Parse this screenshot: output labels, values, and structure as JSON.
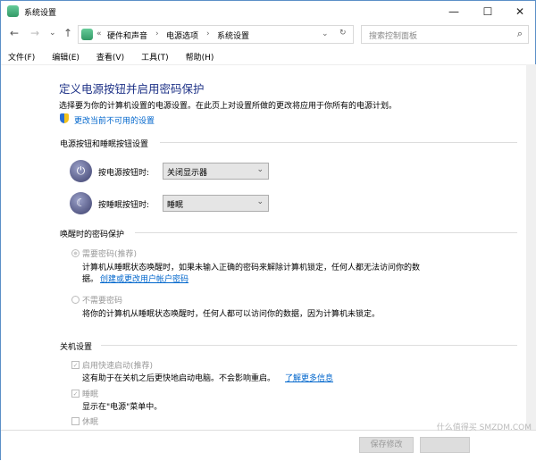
{
  "window": {
    "title": "系统设置",
    "minimize": "—",
    "maximize": "☐",
    "close": "✕"
  },
  "nav": {
    "back": "←",
    "forward": "→",
    "recent": "⌄",
    "up": "↑",
    "refresh": "↻",
    "dropdown": "⌄"
  },
  "address": {
    "prefix": "«",
    "crumbs": [
      "硬件和声音",
      "电源选项",
      "系统设置"
    ],
    "sep": "›"
  },
  "search": {
    "placeholder": "搜索控制面板",
    "icon": "⌕"
  },
  "menu": [
    "文件(F)",
    "编辑(E)",
    "查看(V)",
    "工具(T)",
    "帮助(H)"
  ],
  "page": {
    "heading": "定义电源按钮并启用密码保护",
    "description": "选择要为你的计算机设置的电源设置。在此页上对设置所做的更改将应用于你所有的电源计划。",
    "change_link": "更改当前不可用的设置",
    "section_buttons": "电源按钮和睡眠按钮设置",
    "power_label": "按电源按钮时:",
    "power_value": "关闭显示器",
    "sleep_label": "按睡眠按钮时:",
    "sleep_value": "睡眠",
    "section_password": "唤醒时的密码保护",
    "require_label": "需要密码(推荐)",
    "require_desc": "计算机从睡眠状态唤醒时，如果未输入正确的密码来解除计算机锁定，任何人都无法访问你的数",
    "require_desc2": "据。",
    "require_link": "创建或更改用户帐户密码",
    "norequire_label": "不需要密码",
    "norequire_desc": "将你的计算机从睡眠状态唤醒时，任何人都可以访问你的数据，因为计算机未锁定。",
    "section_shutdown": "关机设置",
    "fast_label": "启用快速启动(推荐)",
    "fast_desc": "这有助于在关机之后更快地启动电脑。不会影响重启。",
    "fast_link": "了解更多信息",
    "sleep_chk": "睡眠",
    "sleep_chk_desc": "显示在\"电源\"菜单中。",
    "hibernate_chk": "休眠"
  },
  "footer": {
    "save": "保存修改"
  },
  "watermark": "什么值得买 SMZDM.COM"
}
